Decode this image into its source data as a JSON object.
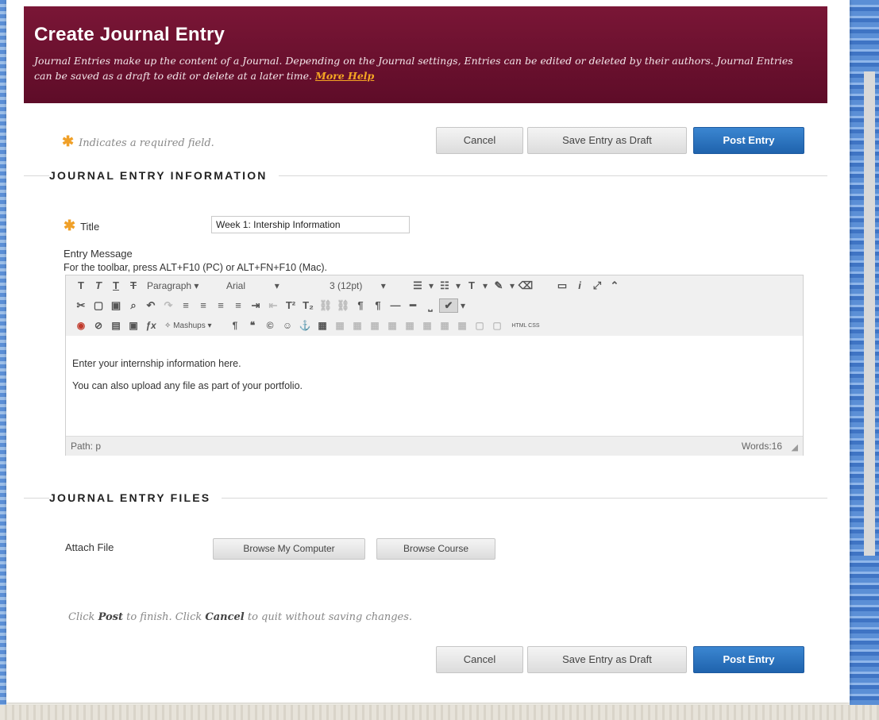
{
  "header": {
    "title": "Create Journal Entry",
    "description": "Journal Entries make up the content of a Journal. Depending on the Journal settings, Entries can be edited or deleted by their authors. Journal Entries can be saved as a draft to edit or delete at a later time.",
    "help_link": "More Help"
  },
  "required_note": "Indicates a required field.",
  "buttons": {
    "cancel": "Cancel",
    "save_draft": "Save Entry as Draft",
    "post": "Post Entry"
  },
  "info_section": {
    "title": "JOURNAL ENTRY INFORMATION",
    "title_label": "Title",
    "title_value": "Week 1: Intership Information",
    "message_label": "Entry Message",
    "toolbar_hint": "For the toolbar, press ALT+F10 (PC) or ALT+FN+F10 (Mac)."
  },
  "editor": {
    "paragraph": "Paragraph",
    "font": "Arial",
    "size": "3 (12pt)",
    "mashups": "Mashups",
    "html_css": "HTML CSS",
    "body_lines": [
      "Enter your internship information here.",
      "You can also upload any file as part of your portfolio."
    ],
    "path": "Path: p",
    "words": "Words:16"
  },
  "files_section": {
    "title": "JOURNAL ENTRY FILES",
    "attach_label": "Attach File",
    "browse_computer": "Browse My Computer",
    "browse_course": "Browse Course"
  },
  "footer": {
    "pre": "Click ",
    "post_word": "Post",
    "mid": " to finish. Click ",
    "cancel_word": "Cancel",
    "end": " to quit without saving changes."
  },
  "colors": {
    "header_bg": "#6b1030",
    "accent_star": "#f0a028",
    "primary_button": "#2a72bf"
  }
}
